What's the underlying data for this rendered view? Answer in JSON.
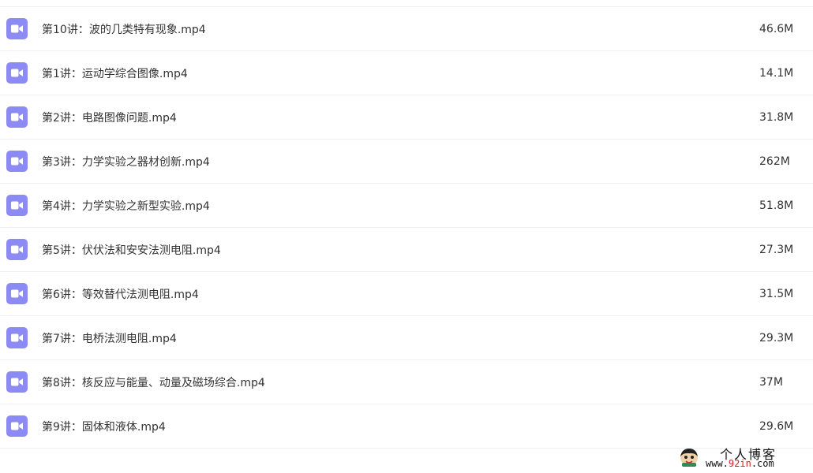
{
  "files": [
    {
      "name": "第10讲：波的几类特有现象.mp4",
      "size": "46.6M",
      "icon": "video-icon"
    },
    {
      "name": "第1讲：运动学综合图像.mp4",
      "size": "14.1M",
      "icon": "video-icon"
    },
    {
      "name": "第2讲：电路图像问题.mp4",
      "size": "31.8M",
      "icon": "video-icon"
    },
    {
      "name": "第3讲：力学实验之器材创新.mp4",
      "size": "262M",
      "icon": "video-icon"
    },
    {
      "name": "第4讲：力学实验之新型实验.mp4",
      "size": "51.8M",
      "icon": "video-icon"
    },
    {
      "name": "第5讲：伏伏法和安安法测电阻.mp4",
      "size": "27.3M",
      "icon": "video-icon"
    },
    {
      "name": "第6讲：等效替代法测电阻.mp4",
      "size": "31.5M",
      "icon": "video-icon"
    },
    {
      "name": "第7讲：电桥法测电阻.mp4",
      "size": "29.3M",
      "icon": "video-icon"
    },
    {
      "name": "第8讲：核反应与能量、动量及磁场综合.mp4",
      "size": "37M",
      "icon": "video-icon"
    },
    {
      "name": "第9讲：固体和液体.mp4",
      "size": "29.6M",
      "icon": "video-icon"
    }
  ],
  "watermark": {
    "title": "个人博客",
    "url_prefix": "www.",
    "url_accent": "92in",
    "url_suffix": ".com"
  },
  "colors": {
    "icon_bg": "#8c8af5",
    "divider": "#eceef2",
    "text": "#333333"
  }
}
